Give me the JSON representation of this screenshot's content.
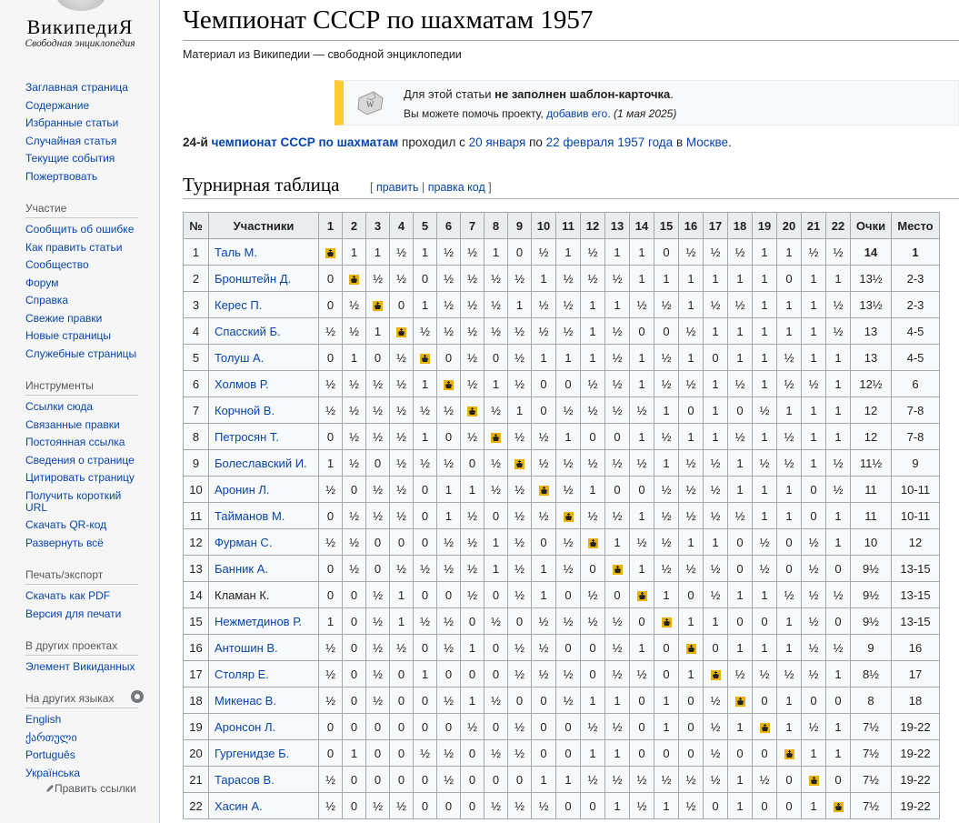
{
  "sidebar": {
    "logo_word": "ВикипедиЯ",
    "logo_tagline": "Свободная энциклопедия",
    "nav": [
      "Заглавная страница",
      "Содержание",
      "Избранные статьи",
      "Случайная статья",
      "Текущие события",
      "Пожертвовать"
    ],
    "participation": {
      "heading": "Участие",
      "items": [
        "Сообщить об ошибке",
        "Как править статьи",
        "Сообщество",
        "Форум",
        "Справка",
        "Свежие правки",
        "Новые страницы",
        "Служебные страницы"
      ]
    },
    "tools": {
      "heading": "Инструменты",
      "items": [
        "Ссылки сюда",
        "Связанные правки",
        "Постоянная ссылка",
        "Сведения о странице",
        "Цитировать страницу",
        "Получить короткий URL",
        "Скачать QR-код",
        "Развернуть всё"
      ]
    },
    "print": {
      "heading": "Печать/экспорт",
      "items": [
        "Скачать как PDF",
        "Версия для печати"
      ]
    },
    "projects": {
      "heading": "В других проектах",
      "items": [
        "Элемент Викиданных"
      ]
    },
    "languages": {
      "heading": "На других языках",
      "items": [
        "English",
        "ქართული",
        "Português",
        "Українська"
      ],
      "edit_links": "Править ссылки"
    }
  },
  "article": {
    "title": "Чемпионат СССР по шахматам 1957",
    "tagline": "Материал из Википедии — свободной энциклопедии",
    "notice": {
      "line1_prefix": "Для этой статьи ",
      "line1_bold": "не заполнен шаблон-карточка",
      "line1_suffix": ".",
      "line2_prefix": "Вы можете помочь проекту, ",
      "line2_link": "добавив его",
      "line2_suffix": ".",
      "line2_date": "(1 мая 2025)"
    },
    "lead": {
      "b1": "24-й ",
      "b2": "чемпионат СССР по шахматам",
      "t1": " проходил с ",
      "l1": "20 января",
      "t2": " по ",
      "l2": "22 февраля",
      "t3": " ",
      "l3": "1957 года",
      "t4": " в ",
      "l4": "Москве",
      "t5": "."
    },
    "section": {
      "title": "Турнирная таблица",
      "edit_open": "[ ",
      "edit_link1": "править",
      "edit_sep": " | ",
      "edit_link2": "правка код",
      "edit_close": " ]"
    }
  },
  "table": {
    "headers": [
      "№",
      "Участники",
      "1",
      "2",
      "3",
      "4",
      "5",
      "6",
      "7",
      "8",
      "9",
      "10",
      "11",
      "12",
      "13",
      "14",
      "15",
      "16",
      "17",
      "18",
      "19",
      "20",
      "21",
      "22",
      "Очки",
      "Место"
    ],
    "rows": [
      {
        "n": "1",
        "name": "Таль М.",
        "r": [
          "X",
          "1",
          "1",
          "½",
          "1",
          "½",
          "½",
          "1",
          "0",
          "½",
          "1",
          "½",
          "1",
          "1",
          "0",
          "½",
          "½",
          "½",
          "1",
          "1",
          "½",
          "½"
        ],
        "pts": "14",
        "place": "1"
      },
      {
        "n": "2",
        "name": "Бронштейн Д.",
        "r": [
          "0",
          "X",
          "½",
          "½",
          "0",
          "½",
          "½",
          "½",
          "½",
          "1",
          "½",
          "½",
          "½",
          "1",
          "1",
          "1",
          "1",
          "1",
          "1",
          "0",
          "1",
          "1"
        ],
        "pts": "13½",
        "place": "2-3"
      },
      {
        "n": "3",
        "name": "Керес П.",
        "r": [
          "0",
          "½",
          "X",
          "0",
          "1",
          "½",
          "½",
          "½",
          "1",
          "½",
          "½",
          "1",
          "1",
          "½",
          "½",
          "1",
          "½",
          "½",
          "1",
          "1",
          "1",
          "½"
        ],
        "pts": "13½",
        "place": "2-3"
      },
      {
        "n": "4",
        "name": "Спасский Б.",
        "r": [
          "½",
          "½",
          "1",
          "X",
          "½",
          "½",
          "½",
          "½",
          "½",
          "½",
          "½",
          "1",
          "½",
          "0",
          "0",
          "½",
          "1",
          "1",
          "1",
          "1",
          "1",
          "½"
        ],
        "pts": "13",
        "place": "4-5"
      },
      {
        "n": "5",
        "name": "Толуш А.",
        "r": [
          "0",
          "1",
          "0",
          "½",
          "X",
          "0",
          "½",
          "0",
          "½",
          "1",
          "1",
          "1",
          "½",
          "1",
          "½",
          "1",
          "0",
          "1",
          "1",
          "½",
          "1",
          "1"
        ],
        "pts": "13",
        "place": "4-5"
      },
      {
        "n": "6",
        "name": "Холмов Р.",
        "r": [
          "½",
          "½",
          "½",
          "½",
          "1",
          "X",
          "½",
          "1",
          "½",
          "0",
          "0",
          "½",
          "½",
          "1",
          "½",
          "½",
          "1",
          "½",
          "1",
          "½",
          "½",
          "1"
        ],
        "pts": "12½",
        "place": "6"
      },
      {
        "n": "7",
        "name": "Корчной В.",
        "r": [
          "½",
          "½",
          "½",
          "½",
          "½",
          "½",
          "X",
          "½",
          "1",
          "0",
          "½",
          "½",
          "½",
          "½",
          "1",
          "0",
          "1",
          "0",
          "½",
          "1",
          "1",
          "1"
        ],
        "pts": "12",
        "place": "7-8"
      },
      {
        "n": "8",
        "name": "Петросян Т.",
        "r": [
          "0",
          "½",
          "½",
          "½",
          "1",
          "0",
          "½",
          "X",
          "½",
          "½",
          "1",
          "0",
          "0",
          "1",
          "½",
          "1",
          "1",
          "½",
          "1",
          "½",
          "1",
          "1"
        ],
        "pts": "12",
        "place": "7-8"
      },
      {
        "n": "9",
        "name": "Болеславский И.",
        "r": [
          "1",
          "½",
          "0",
          "½",
          "½",
          "½",
          "0",
          "½",
          "X",
          "½",
          "½",
          "½",
          "½",
          "½",
          "1",
          "½",
          "½",
          "1",
          "½",
          "½",
          "1",
          "½"
        ],
        "pts": "11½",
        "place": "9"
      },
      {
        "n": "10",
        "name": "Аронин Л.",
        "r": [
          "½",
          "0",
          "½",
          "½",
          "0",
          "1",
          "1",
          "½",
          "½",
          "X",
          "½",
          "1",
          "0",
          "0",
          "½",
          "½",
          "½",
          "1",
          "1",
          "1",
          "0",
          "½"
        ],
        "pts": "11",
        "place": "10-11"
      },
      {
        "n": "11",
        "name": "Тайманов М.",
        "r": [
          "0",
          "½",
          "½",
          "½",
          "0",
          "1",
          "½",
          "0",
          "½",
          "½",
          "X",
          "½",
          "½",
          "1",
          "½",
          "½",
          "½",
          "½",
          "1",
          "1",
          "0",
          "1"
        ],
        "pts": "11",
        "place": "10-11"
      },
      {
        "n": "12",
        "name": "Фурман С.",
        "r": [
          "½",
          "½",
          "0",
          "0",
          "0",
          "½",
          "½",
          "1",
          "½",
          "0",
          "½",
          "X",
          "1",
          "½",
          "½",
          "1",
          "1",
          "0",
          "½",
          "0",
          "½",
          "1"
        ],
        "pts": "10",
        "place": "12"
      },
      {
        "n": "13",
        "name": "Банник А.",
        "r": [
          "0",
          "½",
          "0",
          "½",
          "½",
          "½",
          "½",
          "1",
          "½",
          "1",
          "½",
          "0",
          "X",
          "1",
          "½",
          "½",
          "½",
          "0",
          "½",
          "0",
          "½",
          "0"
        ],
        "pts": "9½",
        "place": "13-15"
      },
      {
        "n": "14",
        "name": "Кламан К.",
        "r": [
          "0",
          "0",
          "½",
          "1",
          "0",
          "0",
          "½",
          "0",
          "½",
          "1",
          "0",
          "½",
          "0",
          "X",
          "1",
          "0",
          "½",
          "1",
          "1",
          "½",
          "½",
          "½"
        ],
        "pts": "9½",
        "place": "13-15"
      },
      {
        "n": "15",
        "name": "Нежметдинов Р.",
        "r": [
          "1",
          "0",
          "½",
          "1",
          "½",
          "½",
          "0",
          "½",
          "0",
          "½",
          "½",
          "½",
          "½",
          "0",
          "X",
          "1",
          "1",
          "0",
          "0",
          "1",
          "½",
          "0"
        ],
        "pts": "9½",
        "place": "13-15"
      },
      {
        "n": "16",
        "name": "Антошин В.",
        "r": [
          "½",
          "0",
          "½",
          "½",
          "0",
          "½",
          "1",
          "0",
          "½",
          "½",
          "0",
          "0",
          "½",
          "1",
          "0",
          "X",
          "0",
          "1",
          "1",
          "1",
          "½",
          "½"
        ],
        "pts": "9",
        "place": "16"
      },
      {
        "n": "17",
        "name": "Столяр Е.",
        "r": [
          "½",
          "0",
          "½",
          "0",
          "1",
          "0",
          "0",
          "0",
          "½",
          "½",
          "½",
          "0",
          "½",
          "½",
          "0",
          "1",
          "X",
          "½",
          "½",
          "½",
          "½",
          "1"
        ],
        "pts": "8½",
        "place": "17"
      },
      {
        "n": "18",
        "name": "Микенас В.",
        "r": [
          "½",
          "0",
          "½",
          "0",
          "0",
          "½",
          "1",
          "½",
          "0",
          "0",
          "½",
          "1",
          "1",
          "0",
          "1",
          "0",
          "½",
          "X",
          "0",
          "1",
          "0",
          "0"
        ],
        "pts": "8",
        "place": "18"
      },
      {
        "n": "19",
        "name": "Аронсон Л.",
        "r": [
          "0",
          "0",
          "0",
          "0",
          "0",
          "0",
          "½",
          "0",
          "½",
          "0",
          "0",
          "½",
          "½",
          "0",
          "1",
          "0",
          "½",
          "1",
          "X",
          "1",
          "½",
          "1"
        ],
        "pts": "7½",
        "place": "19-22"
      },
      {
        "n": "20",
        "name": "Гургенидзе Б.",
        "r": [
          "0",
          "1",
          "0",
          "0",
          "½",
          "½",
          "0",
          "½",
          "½",
          "0",
          "0",
          "1",
          "1",
          "0",
          "0",
          "0",
          "½",
          "0",
          "0",
          "X",
          "1",
          "1"
        ],
        "pts": "7½",
        "place": "19-22"
      },
      {
        "n": "21",
        "name": "Тарасов В.",
        "r": [
          "½",
          "0",
          "0",
          "0",
          "0",
          "½",
          "0",
          "0",
          "0",
          "1",
          "1",
          "½",
          "½",
          "½",
          "½",
          "½",
          "½",
          "1",
          "½",
          "0",
          "X",
          "0"
        ],
        "pts": "7½",
        "place": "19-22"
      },
      {
        "n": "22",
        "name": "Хасин А.",
        "r": [
          "½",
          "0",
          "½",
          "½",
          "0",
          "0",
          "0",
          "½",
          "½",
          "½",
          "0",
          "0",
          "1",
          "½",
          "1",
          "½",
          "0",
          "1",
          "0",
          "0",
          "1",
          "X"
        ],
        "pts": "7½",
        "place": "19-22"
      }
    ]
  },
  "colors": {
    "link": "#0645ad",
    "notice_accent": "#ffcc33",
    "border": "#a2a9b1",
    "header_bg": "#eaecf0"
  },
  "icons": {
    "puzzle": "puzzle-icon",
    "diagonal": "chess-king-icon",
    "settings": "gear-icon",
    "edit": "pencil-icon"
  }
}
